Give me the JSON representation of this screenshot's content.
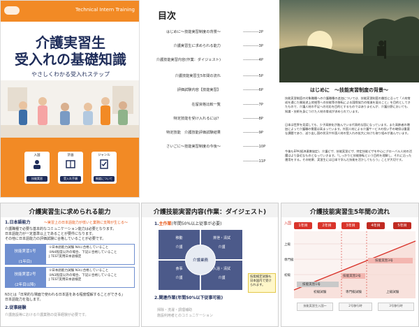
{
  "cover": {
    "series": "Technical Intern Training",
    "title_line1": "介護実習生",
    "title_line2": "受入れの基礎知識",
    "subtitle": "やさしくわかる受入れステップ",
    "cards": [
      {
        "label": "入国",
        "badge": "技能実習",
        "icon": "person-icon"
      },
      {
        "label": "計画",
        "badge": "受入れ手順",
        "icon": "book-icon"
      },
      {
        "label": "ジャンル",
        "badge": "制度について",
        "icon": "checklist-icon"
      }
    ],
    "colors": {
      "accent": "#f28a25",
      "navy": "#1f2d5a"
    }
  },
  "toc": {
    "title": "目次",
    "items": [
      {
        "label": "はじめに～技能実習制度の背景～",
        "page": "------------2P"
      },
      {
        "label": "介護実習生に求められる能力",
        "page": "------------3P"
      },
      {
        "label": "介護技能実習内容(作業：ダイジェスト)",
        "page": "------------4P"
      },
      {
        "label": "介護技能実習生5年間の流れ",
        "page": "------------5P"
      },
      {
        "label": "評価試験内容【技能実習】",
        "page": "------------6P"
      },
      {
        "label": "在留資格比較一覧",
        "page": "------------7P"
      },
      {
        "label": "特定技能を受け入れるには？",
        "page": "------------8P"
      },
      {
        "label": "特定技能　介護技能評価試験結果",
        "page": "------------9P"
      },
      {
        "label": "さいごに～技能実習制度の今後～",
        "page": "------------10P"
      },
      {
        "label": "",
        "page": "------------11P"
      }
    ]
  },
  "intro": {
    "heading": "はじめに　～技能実習制度の背景～",
    "paragraphs": [
      "技能実習制度の対象職種への介護職種の追加については、技能実習制度の趣旨に沿って「人材育成を通じた開発途上地域等への技能等の移転による国際協力の推進を図ること」を目的としてきたもので、介護人材の不足への対応を目的とするものではありませんが、介護分野においても、知識・技術を身につけた人材の育成が求められています。",
      "日本は世界を見渡しても、少子高齢化が進んでいる代表的な国になっています。また高齢者の増加によって介護職の需要は高まっています。外国人材による介護サービスの担い手の確保は重要な課題であり、送り出し国の状況や外国人材の受入れの拡大に向けた取り組みが進んでいます。",
      "今後もEPA(経済連携協定)、介護ビザ、技能実習ビザ、特定技能ビザを中心にグローバル人材の活躍はより身近なものとなっていきます。「しっかりと技能移転という目的を理解し、それに沿った運用をする。その結果、実習生には日本で学んだ技能を活かしてもらう」ことが大切です。"
    ]
  },
  "slide1": {
    "title": "介護実習生に求められる能力",
    "section1": "1.日本語能力",
    "section1_note": "～実習上の日本語能力が低いと業務に支障が生じる～",
    "lines": [
      "介護職種で必要な基本的なコミュニケーション能力は必要となります。",
      "日本語能力が一定基準以上であることが要件になります。",
      "その他に日本語能力の評価試験に合格していることが必要です。"
    ],
    "levels": [
      {
        "label": "技能実習1号",
        "sub": "(1年目)",
        "desc": [
          "①日本語能力試験 N4に合格していること",
          "②N4程度以外の場合、下記に合格していること",
          "J.TEST実用日本語検定"
        ]
      },
      {
        "label": "技能実習2号",
        "sub": "(2年目以降)",
        "desc": [
          "①日本語能力試験 N3に合格していること",
          "②N3程度以外の場合、下記に合格していること",
          "J.TEST実用日本語検定"
        ]
      }
    ],
    "foot_lines": [
      "N3とは「日常的な場面で使われる日本語をある程度理解することができる」",
      "日本語能力を指します。"
    ],
    "section2": "2.従事経験",
    "section2_sub": "介護施設等における介護業務の従事経験が必要です。"
  },
  "slide2": {
    "title": "介護技能実習内容(作業：ダイジェスト)",
    "section1": "1.",
    "section1_emph": "主作業",
    "section1_rest": "(年間50%以上従事が必要)",
    "cells": [
      {
        "title": "移動",
        "sub": "介護"
      },
      {
        "title": "食事",
        "sub": "介護"
      },
      {
        "title": "排泄・清拭",
        "sub": "介護"
      },
      {
        "title": "入浴・清拭",
        "sub": "介護"
      }
    ],
    "center": "介護業務",
    "section2": "2.関連作業(年間50%以下従事可能)",
    "items": [
      "掃除・洗濯・調理補助",
      "施設利用者とのコミュニケーション"
    ],
    "note": "技能検定試験も日本国内で受けられます。"
  },
  "slide3": {
    "title": "介護技能実習生5年間の流れ",
    "years": [
      "1年目",
      "2年目",
      "3年目",
      "4年目",
      "5年目"
    ],
    "entry_label": "入国",
    "axis_labels": [
      "上級",
      "専門級",
      "初級"
    ],
    "bars": [
      "技能実習1号",
      "技能実習2号",
      "技能実習3号"
    ],
    "tests": [
      "初級試験",
      "専門級試験",
      "上級試験"
    ],
    "foot": [
      "技能実習生入国～",
      "2号移行時",
      "3号移行時"
    ]
  }
}
